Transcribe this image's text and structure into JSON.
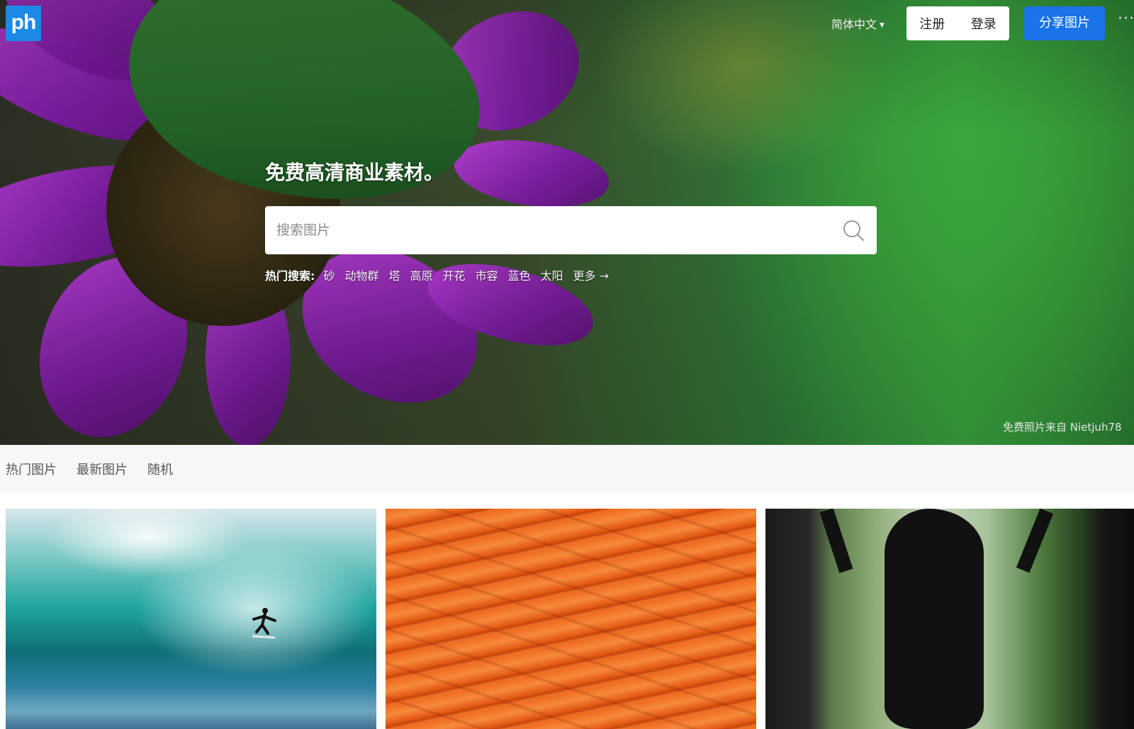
{
  "header": {
    "logo_text": "ph",
    "language": "简体中文",
    "register": "注册",
    "login": "登录",
    "share": "分享图片",
    "more": "···"
  },
  "hero": {
    "tagline": "免费高清商业素材。",
    "search": {
      "placeholder": "搜索图片",
      "value": ""
    },
    "hot_label": "热门搜索:",
    "hot_tags": [
      "砂",
      "动物群",
      "塔",
      "高原",
      "开花",
      "市容",
      "蓝色",
      "太阳"
    ],
    "more_link": "更多 →",
    "credit": "免费照片来自 Nietjuh78"
  },
  "tabs": [
    "热门图片",
    "最新图片",
    "随机"
  ],
  "colors": {
    "brand": "#1b8ae6",
    "share_button": "#1a73e8"
  },
  "icons": {
    "search": "search-icon",
    "caret": "caret-down-icon",
    "more": "more-dots-icon"
  }
}
